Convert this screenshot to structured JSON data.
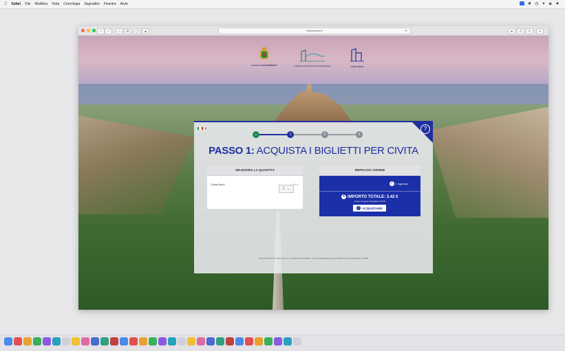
{
  "menubar": {
    "app": "Safari",
    "items": [
      "File",
      "Modifica",
      "Vista",
      "Cronologia",
      "Segnalibri",
      "Finestra",
      "Aiuto"
    ]
  },
  "browser": {
    "url": "civitabcmei.it"
  },
  "page": {
    "logos": [
      {
        "name": "Comune di Bagnoregio",
        "text": "Comune di BAGNOREGIO"
      },
      {
        "name": "Paesaggio",
        "text": "IL PAESAGGIO CULTURALE DI CIVITA DI BAGNOREGIO"
      },
      {
        "name": "Casa Civita",
        "text": "CASA CIVITA"
      }
    ],
    "title_bold": "PASSO 1:",
    "title_rest": " ACQUISTA I BIGLIETTI PER CIVITA",
    "steps": [
      {
        "label": "home",
        "state": "done"
      },
      {
        "label": "1",
        "state": "active"
      },
      {
        "label": "2",
        "state": "todo"
      },
      {
        "label": "3",
        "state": "todo"
      }
    ],
    "help_symbol": "?",
    "quantity_panel": {
      "header": "SELEZIONA LA QUANTITÀ",
      "product_name": "Civita Demi",
      "quantity": "1",
      "price": "0,00 €"
    },
    "order_panel": {
      "header": "RIEPILOGO ORDINE",
      "cart_text": "1 ingresso",
      "total_label": "IMPORTO TOTALE: 3.42 €",
      "fees_text": "comp. le spese di gestione 0.42 €",
      "buy_label": "ACQUISTARE"
    },
    "footer": "Servizio offerto per vacuay.com - licensed by Archeaware - per Civita di Bagnoregio | Artisbering 6.0.0 Copyright © 2020"
  },
  "colors": {
    "accent": "#1f2fa0",
    "order_blue": "#1b2fa8"
  },
  "dock_icons": [
    "finder",
    "launchpad",
    "safari",
    "chrome",
    "messages",
    "mail",
    "maps",
    "photos",
    "facetime",
    "calendar",
    "notes",
    "reminders",
    "app-store",
    "system-preferences",
    "music",
    "podcasts",
    "tv",
    "books",
    "premiere",
    "after-effects",
    "xd",
    "illustrator",
    "photoshop",
    "indesign",
    "word",
    "excel",
    "powerpoint",
    "teams",
    "zoom",
    "skype",
    "trash"
  ]
}
